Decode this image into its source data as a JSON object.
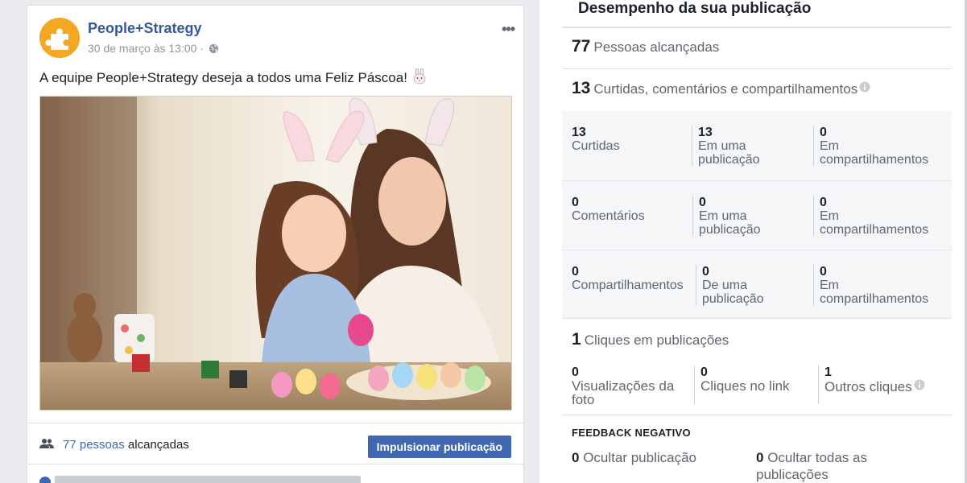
{
  "post": {
    "page_name": "People+Strategy",
    "timestamp": "30 de março às 13:00 · ",
    "message": "A equipe People+Strategy deseja a todos uma Feliz Páscoa!",
    "reach_count_link": "77 pessoas",
    "reach_suffix": " alcançadas",
    "boost_label": "Impulsionar publicação"
  },
  "panel": {
    "title": "Desempenho da sua publicação",
    "reach": {
      "value": "77",
      "label": "Pessoas alcançadas"
    },
    "engagement": {
      "value": "13",
      "label": "Curtidas, comentários e compartilhamentos"
    },
    "stats": [
      [
        {
          "value": "13",
          "label": "Curtidas"
        },
        {
          "value": "13",
          "label": "Em uma publicação"
        },
        {
          "value": "0",
          "label": "Em compartilhamentos"
        }
      ],
      [
        {
          "value": "0",
          "label": "Comentários"
        },
        {
          "value": "0",
          "label": "Em uma publicação"
        },
        {
          "value": "0",
          "label": "Em compartilhamentos"
        }
      ],
      [
        {
          "value": "0",
          "label": "Compartilhamentos"
        },
        {
          "value": "0",
          "label": "De uma publicação"
        },
        {
          "value": "0",
          "label": "Em compartilhamentos"
        }
      ]
    ],
    "clicks": {
      "value": "1",
      "label": "Cliques em publicações",
      "items": [
        {
          "value": "0",
          "label": "Visualizações da foto"
        },
        {
          "value": "0",
          "label": "Cliques no link"
        },
        {
          "value": "1",
          "label": "Outros cliques"
        }
      ]
    },
    "negative_feedback": {
      "title": "FEEDBACK NEGATIVO",
      "items": [
        {
          "value": "0",
          "label": "Ocultar publicação"
        },
        {
          "value": "0",
          "label": "Ocultar todas as publicações"
        }
      ]
    }
  },
  "colors": {
    "link": "#4267b2",
    "page_name": "#365899",
    "avatar": "#f5a623"
  },
  "icons": [
    "more-icon",
    "globe-icon",
    "bunny-emoji-icon",
    "people-icon",
    "info-icon",
    "puzzle-logo-icon"
  ]
}
